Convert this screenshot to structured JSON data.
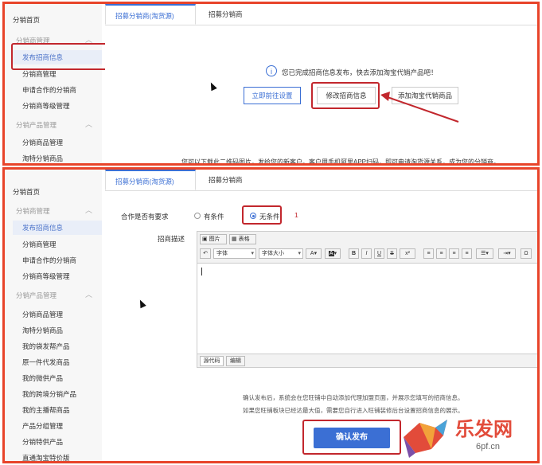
{
  "top": {
    "sidebar": {
      "home": "分销首页",
      "group_dist": "分销商管理",
      "active_item": "发布招商信息",
      "items_dist": [
        "分销商管理",
        "申请合作的分销商",
        "分销商等级管理"
      ],
      "group_products": "分销产品管理",
      "items_products": [
        "分销商品管理",
        "淘特分销商品"
      ]
    },
    "tabs": [
      "招募分销商(淘货源)",
      "招募分销商"
    ],
    "notice": "您已完成招商信息发布，快去添加淘宝代销产品吧！",
    "buttons": {
      "setup": "立即前往设置",
      "modify": "修改招商信息",
      "add_products": "添加淘宝代销商品"
    },
    "footer": "您可以下载此二维码图片，发给您的新客户。客户用手机阿里APP扫码，即可申请淘货源关系，成为您的分销商。"
  },
  "bottom": {
    "sidebar": {
      "home": "分销首页",
      "group_dist": "分销商管理",
      "active_item": "发布招商信息",
      "items_dist": [
        "分销商管理",
        "申请合作的分销商",
        "分销商等级管理"
      ],
      "group_products": "分销产品管理",
      "items_products": [
        "分销商品管理",
        "淘特分销商品",
        "我的袋发帮产品",
        "原一件代发商品",
        "我的微供产品",
        "我的跨境分销产品",
        "我的主播帮商品",
        "产品分组管理",
        "分销特供产品",
        "直通淘宝特价版"
      ]
    },
    "tabs": [
      "招募分销商(淘货源)",
      "招募分销商"
    ],
    "form": {
      "requirement_label": "合作是否有要求",
      "option_conditional": "有条件",
      "option_unconditional": "无条件",
      "annotation_number": "1",
      "description_label": "招商描述"
    },
    "editor": {
      "image_btn": "图片",
      "table_btn": "表格",
      "font_select": "字体",
      "size_select": "字体大小",
      "bold": "B",
      "italic": "I",
      "underline": "U",
      "strike": "S",
      "superscript": "x²",
      "omega": "Ω",
      "text_color": "A",
      "bg_color": "A",
      "source_tab": "源代码",
      "edit_tab": "编辑"
    },
    "notes": [
      "确认发布后，系统会在您旺铺中自动添加代理加盟页面，并展示您填写的招商信息。",
      "如果您旺铺板块已经达最大值，需要您自行进入旺铺装修后台设置招商信息的展示。"
    ],
    "submit": "确认发布"
  },
  "watermark": {
    "brand": "乐发网",
    "domain": "6pf.cn"
  },
  "colors": {
    "accent": "#3b6fd4",
    "highlight_box": "#c2272d",
    "panel_border": "#e8442a"
  }
}
